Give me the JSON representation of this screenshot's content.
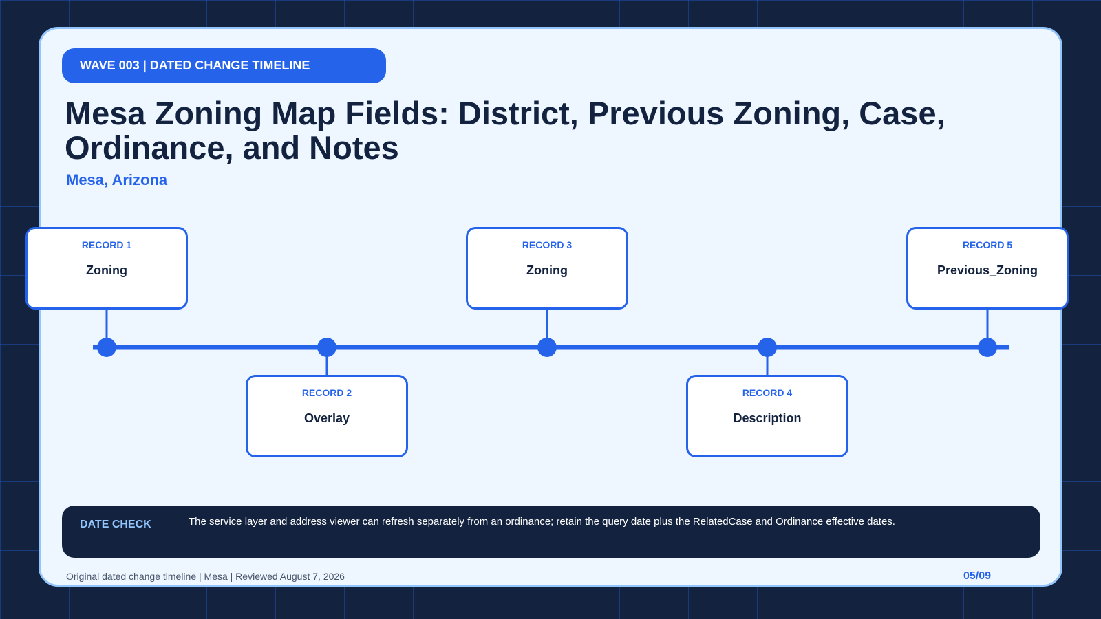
{
  "header": {
    "badge": "WAVE 003 | DATED CHANGE TIMELINE",
    "title": "Mesa Zoning Map Fields: District, Previous Zoning, Case, Ordinance, and Notes",
    "subtitle": "Mesa, Arizona"
  },
  "timeline": {
    "records": [
      {
        "label": "RECORD 1",
        "value": "Zoning"
      },
      {
        "label": "RECORD 2",
        "value": "Overlay"
      },
      {
        "label": "RECORD 3",
        "value": "Zoning"
      },
      {
        "label": "RECORD 4",
        "value": "Description"
      },
      {
        "label": "RECORD 5",
        "value": "Previous_Zoning"
      }
    ]
  },
  "date_check": {
    "label": "DATE CHECK",
    "text": "The service layer and address viewer can refresh separately from an ordinance; retain the query date plus the RelatedCase and Ordinance effective dates."
  },
  "footer": {
    "text": "Original dated change timeline | Mesa | Reviewed August 7, 2026",
    "page": "05/09"
  },
  "colors": {
    "accent": "#2563eb",
    "navy": "#13233f",
    "light_blue": "#93c5fd",
    "card_bg": "#eef6ff"
  }
}
